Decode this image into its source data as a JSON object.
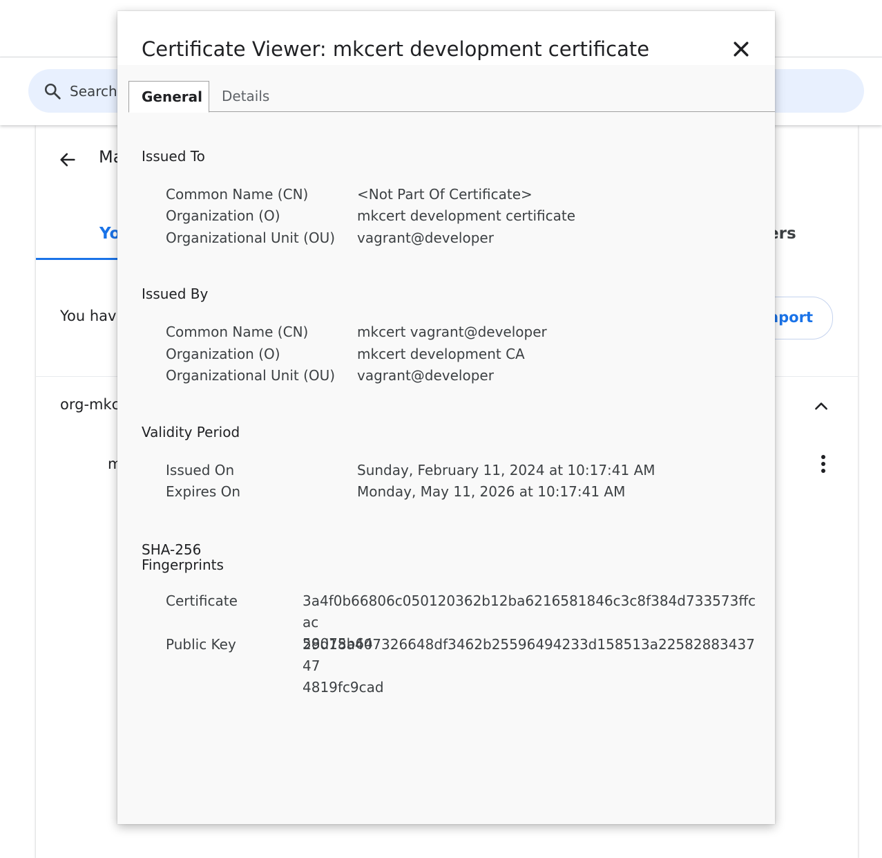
{
  "background": {
    "search_placeholder": "Search",
    "card_title_partial": "Ma",
    "tab_your_partial": "Yo",
    "tab_others_partial": "ers",
    "you_have_partial": "You hav",
    "import_partial": "mport",
    "org_partial": "org-mkc",
    "cert_row_partial": "m"
  },
  "dialog": {
    "title": "Certificate Viewer: mkcert development certificate",
    "tabs": [
      "General",
      "Details"
    ],
    "issued_to": {
      "heading": "Issued To",
      "rows": [
        {
          "label": "Common Name (CN)",
          "value": "<Not Part Of Certificate>"
        },
        {
          "label": "Organization (O)",
          "value": "mkcert development certificate"
        },
        {
          "label": "Organizational Unit (OU)",
          "value": "vagrant@developer"
        }
      ]
    },
    "issued_by": {
      "heading": "Issued By",
      "rows": [
        {
          "label": "Common Name (CN)",
          "value": "mkcert vagrant@developer"
        },
        {
          "label": "Organization (O)",
          "value": "mkcert development CA"
        },
        {
          "label": "Organizational Unit (OU)",
          "value": "vagrant@developer"
        }
      ]
    },
    "validity": {
      "heading": "Validity Period",
      "rows": [
        {
          "label": "Issued On",
          "value": "Sunday, February 11, 2024 at 10:17:41 AM"
        },
        {
          "label": "Expires On",
          "value": "Monday, May 11, 2026 at 10:17:41 AM"
        }
      ]
    },
    "fingerprints": {
      "heading_line1": "SHA-256",
      "heading_line2": "Fingerprints",
      "certificate_label": "Certificate",
      "certificate_line1": "3a4f0b66806c050120362b12ba6216581846c3c8f384d733573ffcac",
      "certificate_line2": "58075b64",
      "public_key_label": "Public Key",
      "public_key_line1": "29d18a407326648df3462b25596494233d158513a2258288343747",
      "public_key_line2": "4819fc9cad"
    }
  },
  "icons": {
    "search": "search-icon",
    "back": "arrow-back-icon",
    "chevron": "chevron-up-icon",
    "more": "more-vert-icon",
    "close": "close-icon"
  },
  "colors": {
    "accent": "#1a73e8",
    "search_bg": "#e8f0fe",
    "dialog_bg": "#f9f9f9"
  }
}
